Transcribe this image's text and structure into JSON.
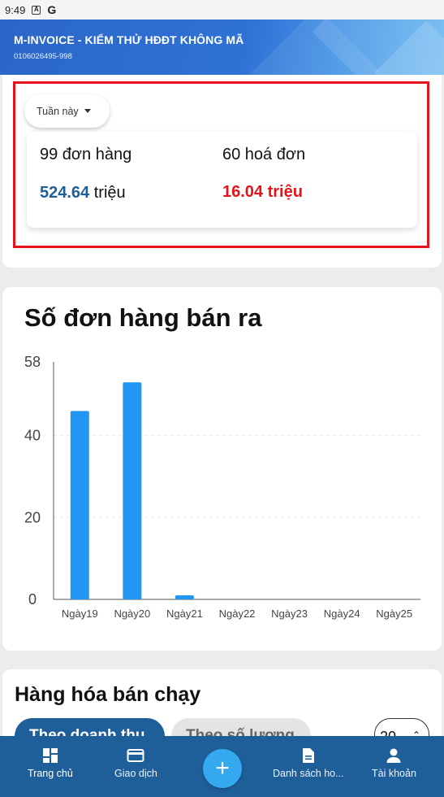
{
  "status_bar": {
    "time": "9:49"
  },
  "header": {
    "title": "M-INVOICE - KIỂM THỬ HĐĐT KHÔNG MÃ",
    "tax_code": "0106026495-998"
  },
  "summary": {
    "period_label": "Tuần này",
    "orders_text": "99 đơn hàng",
    "invoices_text": "60 hoá đơn",
    "revenue_value": "524.64",
    "revenue_unit": "triệu",
    "tax_text": "16.04 triệu"
  },
  "chart_data": {
    "type": "bar",
    "title": "Số đơn hàng bán ra",
    "categories": [
      "Ngày19",
      "Ngày20",
      "Ngày21",
      "Ngày22",
      "Ngày23",
      "Ngày24",
      "Ngày25"
    ],
    "values": [
      46,
      53,
      1,
      0,
      0,
      0,
      0
    ],
    "yticks": [
      0,
      20,
      40,
      58
    ],
    "ylim": [
      0,
      58
    ],
    "grid": true,
    "bar_color": "#2196f3"
  },
  "best_sellers": {
    "title": "Hàng hóa bán chạy",
    "tab_revenue": "Theo doanh thu",
    "tab_quantity": "Theo số lượng",
    "top_count": "20"
  },
  "nav": {
    "home": "Trang chủ",
    "transactions": "Giao dịch",
    "add": "+",
    "invoice_list": "Danh sách ho...",
    "account": "Tài khoản"
  },
  "colors": {
    "primary": "#1f5f99",
    "accent_red": "#e5141b",
    "fab": "#34a9ef"
  }
}
